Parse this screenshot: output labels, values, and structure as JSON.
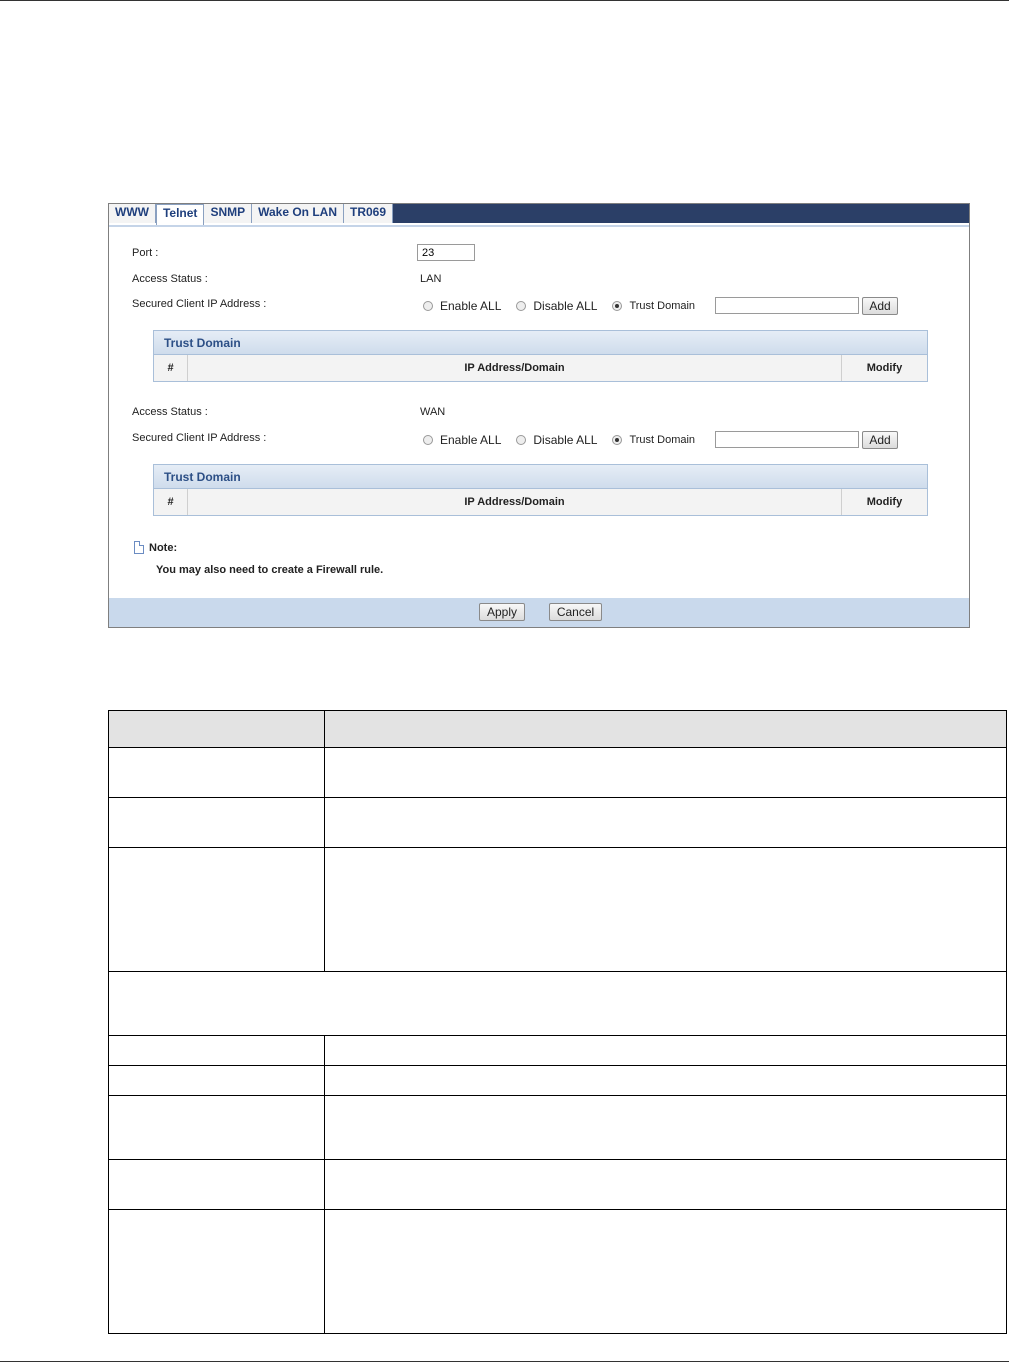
{
  "tabs": [
    "WWW",
    "Telnet",
    "SNMP",
    "Wake On LAN",
    "TR069"
  ],
  "active_tab": "Telnet",
  "form": {
    "port_label": "Port :",
    "port_value": "23",
    "lan": {
      "access_status_label": "Access Status :",
      "access_status_value": "LAN",
      "secured_label": "Secured Client IP Address :",
      "options": [
        "Enable ALL",
        "Disable ALL",
        "Trust Domain"
      ],
      "selected": "Trust Domain",
      "domain_value": "",
      "add_label": "Add"
    },
    "wan": {
      "access_status_label": "Access Status :",
      "access_status_value": "WAN",
      "secured_label": "Secured Client IP Address :",
      "options": [
        "Enable ALL",
        "Disable ALL",
        "Trust Domain"
      ],
      "selected": "Trust Domain",
      "domain_value": "",
      "add_label": "Add"
    }
  },
  "trust_table": {
    "title": "Trust Domain",
    "columns": [
      "#",
      "IP Address/Domain",
      "Modify"
    ]
  },
  "note": {
    "title": "Note:",
    "text": "You may also need to create a Firewall rule."
  },
  "footer": {
    "apply_label": "Apply",
    "cancel_label": "Cancel"
  },
  "colors": {
    "tabbar": "#2b3f67",
    "footer": "#c9d9ec",
    "table_header": "#e3e3e3"
  }
}
